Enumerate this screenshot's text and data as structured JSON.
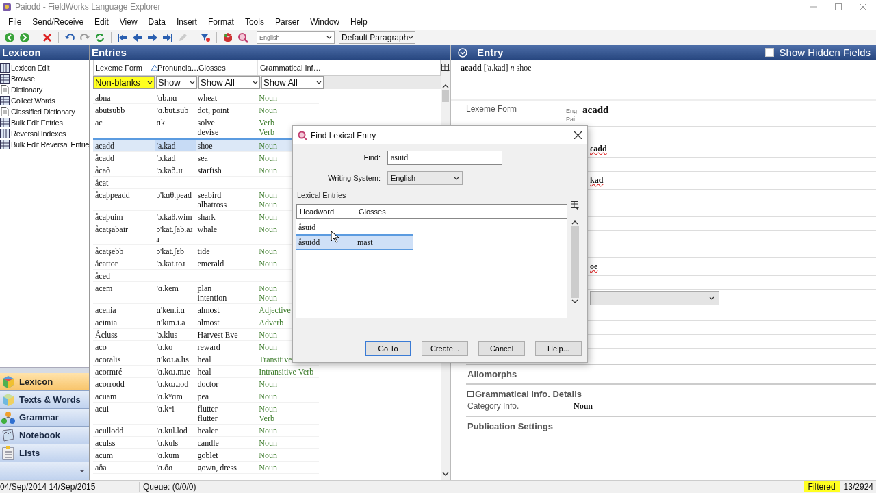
{
  "window": {
    "title": "Paiodd - FieldWorks Language Explorer"
  },
  "menu": [
    "File",
    "Send/Receive",
    "Edit",
    "View",
    "Data",
    "Insert",
    "Format",
    "Tools",
    "Parser",
    "Window",
    "Help"
  ],
  "toolbar": {
    "writing_system": "English",
    "style": "Default Paragraph"
  },
  "sidebar": {
    "title": "Lexicon",
    "tools": [
      {
        "label": "Lexicon Edit",
        "kind": "columns"
      },
      {
        "label": "Browse",
        "kind": "grid"
      },
      {
        "label": "Dictionary",
        "kind": "document"
      },
      {
        "label": "Collect Words",
        "kind": "grid"
      },
      {
        "label": "Classified Dictionary",
        "kind": "document"
      },
      {
        "label": "Bulk Edit Entries",
        "kind": "grid"
      },
      {
        "label": "Reversal Indexes",
        "kind": "columns"
      },
      {
        "label": "Bulk Edit Reversal Entrie",
        "kind": "grid"
      }
    ],
    "areas": [
      {
        "label": "Lexicon",
        "kind": "lexicon",
        "selected": true
      },
      {
        "label": "Texts & Words",
        "kind": "texts",
        "selected": false
      },
      {
        "label": "Grammar",
        "kind": "grammar",
        "selected": false
      },
      {
        "label": "Notebook",
        "kind": "notebook",
        "selected": false
      },
      {
        "label": "Lists",
        "kind": "lists",
        "selected": false
      }
    ]
  },
  "entries": {
    "title": "Entries",
    "columns": [
      {
        "label": "Lexeme Form",
        "sorted": true
      },
      {
        "label": "Pronuncia…",
        "sorted": false
      },
      {
        "label": "Glosses",
        "sorted": false
      },
      {
        "label": "Grammatical Inf…",
        "sorted": false
      }
    ],
    "filters": [
      {
        "label": "Non-blanks",
        "active": true
      },
      {
        "label": "Show",
        "active": false
      },
      {
        "label": "Show All",
        "active": false
      },
      {
        "label": "Show All",
        "active": false
      }
    ],
    "rows": [
      {
        "lexeme": "abna",
        "pronunciation": "'ɑb.nɑ",
        "glosses": [
          "wheat"
        ],
        "categories": [
          "Noun"
        ],
        "selected": false
      },
      {
        "lexeme": "abutsubb",
        "pronunciation": "'ɑ.but.sub",
        "glosses": [
          "dot, point"
        ],
        "categories": [
          "Noun"
        ],
        "selected": false
      },
      {
        "lexeme": "ac",
        "pronunciation": "ɑk",
        "glosses": [
          "solve",
          "devise"
        ],
        "categories": [
          "Verb",
          "Verb"
        ],
        "selected": false
      },
      {
        "lexeme": "acadd",
        "pronunciation": "'a.kad",
        "glosses": [
          "shoe"
        ],
        "categories": [
          "Noun"
        ],
        "selected": true
      },
      {
        "lexeme": "åcadd",
        "pronunciation": "'ɔ.kad",
        "glosses": [
          "sea"
        ],
        "categories": [
          "Noun"
        ],
        "selected": false
      },
      {
        "lexeme": "åcað",
        "pronunciation": "'ɔ.kað.ɹɪ",
        "glosses": [
          "starfish"
        ],
        "categories": [
          "Noun"
        ],
        "selected": false
      },
      {
        "lexeme": "åcat",
        "pronunciation": "",
        "glosses": [],
        "categories": [],
        "selected": false
      },
      {
        "lexeme": "åcaþpeadd",
        "pronunciation": "ɔ'kɑθ.pead",
        "glosses": [
          "seabird",
          "albatross"
        ],
        "categories": [
          "Noun",
          "Noun"
        ],
        "selected": false
      },
      {
        "lexeme": "åcaþuim",
        "pronunciation": "'ɔ.kaθ.wim",
        "glosses": [
          "shark"
        ],
        "categories": [
          "Noun"
        ],
        "selected": false
      },
      {
        "lexeme": "åcatşabair",
        "pronunciation": "ɔ'kat.ʃab.aɹ ɹ",
        "glosses": [
          "whale"
        ],
        "categories": [
          "Noun"
        ],
        "selected": false
      },
      {
        "lexeme": "åcatşebb",
        "pronunciation": "ɔ'kat.ʃɛb",
        "glosses": [
          "tide"
        ],
        "categories": [
          "Noun"
        ],
        "selected": false
      },
      {
        "lexeme": "åcattor",
        "pronunciation": "'ɔ.kat.toɹ",
        "glosses": [
          "emerald"
        ],
        "categories": [
          "Noun"
        ],
        "selected": false
      },
      {
        "lexeme": "åced",
        "pronunciation": "",
        "glosses": [],
        "categories": [],
        "selected": false
      },
      {
        "lexeme": "acem",
        "pronunciation": "'ɑ.kem",
        "glosses": [
          "plan",
          "intention"
        ],
        "categories": [
          "Noun",
          "Noun"
        ],
        "selected": false
      },
      {
        "lexeme": "acenia",
        "pronunciation": "ɑ'ken.i.ɑ",
        "glosses": [
          "almost"
        ],
        "categories": [
          "Adjective"
        ],
        "selected": false
      },
      {
        "lexeme": "acimia",
        "pronunciation": "ɑ'kɪm.i.a",
        "glosses": [
          "almost"
        ],
        "categories": [
          "Adverb"
        ],
        "selected": false
      },
      {
        "lexeme": "Åcluss",
        "pronunciation": "'ɔ.klus",
        "glosses": [
          "Harvest Eve"
        ],
        "categories": [
          "Noun"
        ],
        "selected": false
      },
      {
        "lexeme": "aco",
        "pronunciation": "'ɑ.ko",
        "glosses": [
          "reward"
        ],
        "categories": [
          "Noun"
        ],
        "selected": false
      },
      {
        "lexeme": "acoralis",
        "pronunciation": "ɑ'koɹ.a.lɪs",
        "glosses": [
          "heal"
        ],
        "categories": [
          "Transitive"
        ],
        "selected": false
      },
      {
        "lexeme": "acormré",
        "pronunciation": "'ɑ.koɹ.mɹe",
        "glosses": [
          "heal"
        ],
        "categories": [
          "Intransitive Verb"
        ],
        "selected": false
      },
      {
        "lexeme": "acorrodd",
        "pronunciation": "'ɑ.koɹ.ɹod",
        "glosses": [
          "doctor"
        ],
        "categories": [
          "Noun"
        ],
        "selected": false
      },
      {
        "lexeme": "acuam",
        "pronunciation": "'ɑ.kʷɑm",
        "glosses": [
          "pea"
        ],
        "categories": [
          "Noun"
        ],
        "selected": false
      },
      {
        "lexeme": "acui",
        "pronunciation": "'ɑ.kʷi",
        "glosses": [
          "flutter",
          "flutter"
        ],
        "categories": [
          "Noun",
          "Verb"
        ],
        "selected": false
      },
      {
        "lexeme": "acullodd",
        "pronunciation": "'ɑ.kul.lod",
        "glosses": [
          "healer"
        ],
        "categories": [
          "Noun"
        ],
        "selected": false
      },
      {
        "lexeme": "aculss",
        "pronunciation": "'ɑ.kuls",
        "glosses": [
          "candle"
        ],
        "categories": [
          "Noun"
        ],
        "selected": false
      },
      {
        "lexeme": "acum",
        "pronunciation": "'ɑ.kum",
        "glosses": [
          "goblet"
        ],
        "categories": [
          "Noun"
        ],
        "selected": false
      },
      {
        "lexeme": "aða",
        "pronunciation": "'ɑ.ðɑ",
        "glosses": [
          "gown, dress"
        ],
        "categories": [
          "Noun"
        ],
        "selected": false
      }
    ]
  },
  "entry": {
    "title": "Entry",
    "show_hidden_fields": {
      "label": "Show Hidden Fields",
      "checked": false
    },
    "summary": "**acadd**  ['a.kad] *n*  shoe",
    "lexeme_form": {
      "label": "Lexeme Form",
      "alternatives": [
        {
          "ws": "Eng",
          "value": "acadd"
        },
        {
          "ws": "Pai"
        }
      ]
    },
    "rows": [
      {
        "kind": "empty"
      },
      {
        "kind": "text",
        "value": "cadd",
        "misspelled": true
      },
      {
        "kind": "empty"
      },
      {
        "kind": "text",
        "value": "kad",
        "misspelled": true
      },
      {
        "kind": "empty"
      },
      {
        "kind": "empty"
      },
      {
        "kind": "empty"
      },
      {
        "kind": "empty"
      },
      {
        "kind": "empty"
      },
      {
        "kind": "text",
        "value": "oe",
        "misspelled": true
      },
      {
        "kind": "empty"
      },
      {
        "kind": "dropdown"
      },
      {
        "kind": "empty"
      },
      {
        "kind": "empty"
      },
      {
        "kind": "empty"
      }
    ],
    "sections": [
      {
        "kind": "heading",
        "label": "Allomorphs"
      },
      {
        "kind": "group",
        "label": "Grammatical Info. Details",
        "expanded": true,
        "fields": [
          {
            "label": "Category Info.",
            "value": "Noun"
          }
        ]
      },
      {
        "kind": "heading",
        "label": "Publication Settings"
      }
    ]
  },
  "dialog": {
    "title": "Find Lexical Entry",
    "find_label": "Find:",
    "find_value": "asuid",
    "ws_label": "Writing System:",
    "ws_value": "English",
    "list_title": "Lexical Entries",
    "columns": [
      "Headword",
      "Glosses"
    ],
    "results": [
      {
        "headword": "åsuid",
        "selected": false
      },
      {
        "headword": "åsuidd",
        "gloss": "mast",
        "selected": true
      }
    ],
    "buttons": [
      {
        "label": "Go To",
        "default": true
      },
      {
        "label": "Create...",
        "default": false
      },
      {
        "label": "Cancel",
        "default": false
      },
      {
        "label": "Help...",
        "default": false
      }
    ]
  },
  "status_bar": {
    "dates": "04/Sep/2014 14/Sep/2015",
    "queue": "Queue: (0/0/0)",
    "filter": "Filtered",
    "count": "13/2924"
  }
}
